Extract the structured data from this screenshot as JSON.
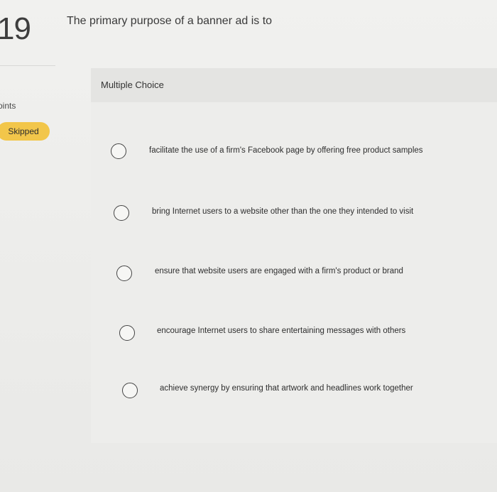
{
  "question": {
    "number": "19",
    "text": "The primary purpose of a banner ad is to",
    "points_label": "oints",
    "status": "Skipped"
  },
  "answer_section": {
    "type_label": "Multiple Choice",
    "choices": [
      {
        "label": "facilitate the use of a firm's Facebook page by offering free product samples"
      },
      {
        "label": "bring Internet users to a website other than the one they intended to visit"
      },
      {
        "label": "ensure that website users are engaged with a firm's product or brand"
      },
      {
        "label": "encourage Internet users to share entertaining messages with others"
      },
      {
        "label": "achieve synergy by ensuring that artwork and headlines work together"
      }
    ]
  },
  "colors": {
    "badge": "#f2c64a",
    "background": "#efefed"
  }
}
